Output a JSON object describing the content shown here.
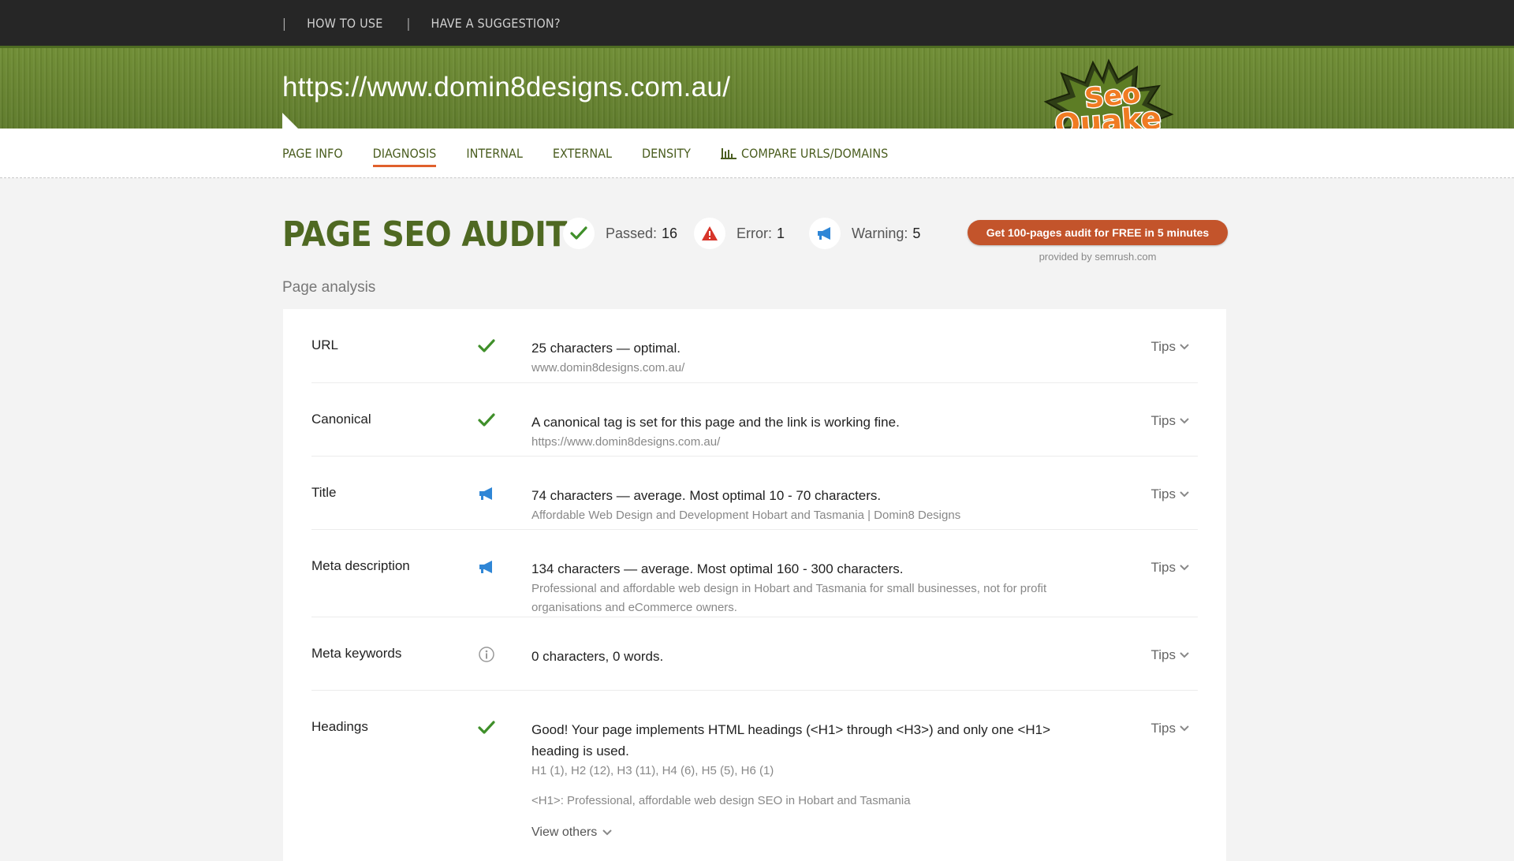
{
  "topnav": {
    "separator": "|",
    "how_to_use": "HOW TO USE",
    "suggestion": "HAVE A SUGGESTION?"
  },
  "header": {
    "url": "https://www.domin8designs.com.au/",
    "logo_top": "Seo",
    "logo_bottom": "Quake"
  },
  "tabs": [
    {
      "label": "PAGE INFO",
      "active": false
    },
    {
      "label": "DIAGNOSIS",
      "active": true
    },
    {
      "label": "INTERNAL",
      "active": false
    },
    {
      "label": "EXTERNAL",
      "active": false
    },
    {
      "label": "DENSITY",
      "active": false
    },
    {
      "label": "COMPARE URLS/DOMAINS",
      "active": false,
      "icon": "bar-chart-icon"
    }
  ],
  "audit": {
    "title": "PAGE SEO AUDIT",
    "passed_label": "Passed:",
    "passed_value": "16",
    "error_label": "Error:",
    "error_value": "1",
    "warning_label": "Warning:",
    "warning_value": "5",
    "cta_label": "Get 100-pages audit for FREE in 5 minutes",
    "provided_by": "provided by  semrush.com",
    "section_label": "Page analysis",
    "colors": {
      "passed": "#3f8f2a",
      "error": "#d7352a",
      "warning": "#2f86d6",
      "cta": "#c3542b"
    }
  },
  "rows": [
    {
      "name": "URL",
      "status_icon": "check-icon",
      "message": "25 characters — optimal.",
      "detail": "www.domin8designs.com.au/",
      "tips": "Tips"
    },
    {
      "name": "Canonical",
      "status_icon": "check-icon",
      "message": "A canonical tag is set for this page and the link is working fine.",
      "detail": "https://www.domin8designs.com.au/",
      "tips": "Tips"
    },
    {
      "name": "Title",
      "status_icon": "megaphone-icon",
      "message": "74 characters — average. Most optimal 10 - 70 characters.",
      "detail": "Affordable Web Design and Development Hobart and Tasmania | Domin8 Designs",
      "tips": "Tips"
    },
    {
      "name": "Meta description",
      "status_icon": "megaphone-icon",
      "message": "134 characters — average. Most optimal 160 - 300 characters.",
      "detail": "Professional and affordable web design in Hobart and Tasmania for small businesses, not for profit organisations and eCommerce owners.",
      "tips": "Tips"
    },
    {
      "name": "Meta keywords",
      "status_icon": "info-icon",
      "message": "0 characters, 0 words.",
      "detail": "",
      "tips": "Tips"
    },
    {
      "name": "Headings",
      "status_icon": "check-icon",
      "message": "Good! Your page implements HTML headings (<H1> through <H3>) and only one <H1> heading is used.",
      "detail": "H1 (1), H2 (12), H3 (11), H4 (6), H5 (5), H6 (1)",
      "detail2": "<H1>: Professional, affordable web design SEO in Hobart and Tasmania",
      "view_others": "View others",
      "tips": "Tips"
    }
  ]
}
